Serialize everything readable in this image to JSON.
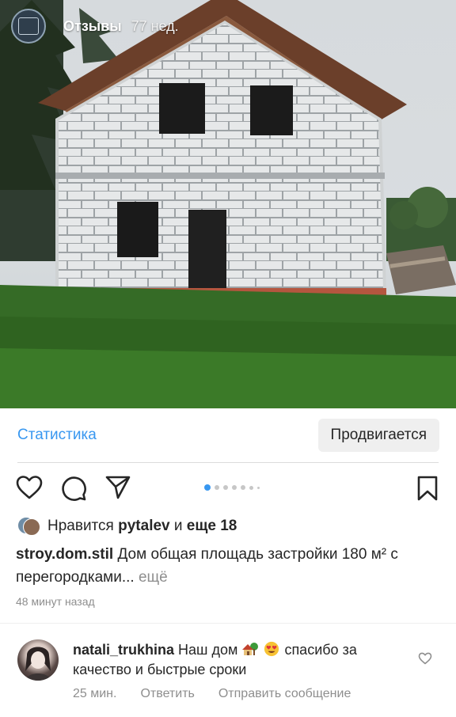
{
  "story": {
    "title": "Отзывы",
    "time": "77 нед."
  },
  "post": {
    "stats_label": "Статистика",
    "promote_label": "Продвигается",
    "carousel": {
      "count": 7,
      "active": 0
    },
    "likes": {
      "prefix": "Нравится",
      "user": "pytalev",
      "connector": "и",
      "others": "еще 18"
    },
    "caption": {
      "username": "stroy.dom.stil",
      "text": "Дом общая площадь застройки 180 м² с перегородками...",
      "more": "ещё"
    },
    "time": "48 минут назад"
  },
  "comment": {
    "username": "natali_trukhina",
    "text_before": "Наш дом",
    "text_after": "спасибо за качество и быстрые сроки",
    "time": "25 мин.",
    "reply_label": "Ответить",
    "send_label": "Отправить сообщение"
  },
  "icons": {
    "heart": "heart-icon",
    "comment": "comment-icon",
    "share": "share-icon",
    "bookmark": "bookmark-icon"
  },
  "colors": {
    "link": "#3897f0",
    "text": "#262626",
    "muted": "#8e8e8e",
    "active_dot": "#3897f0"
  }
}
